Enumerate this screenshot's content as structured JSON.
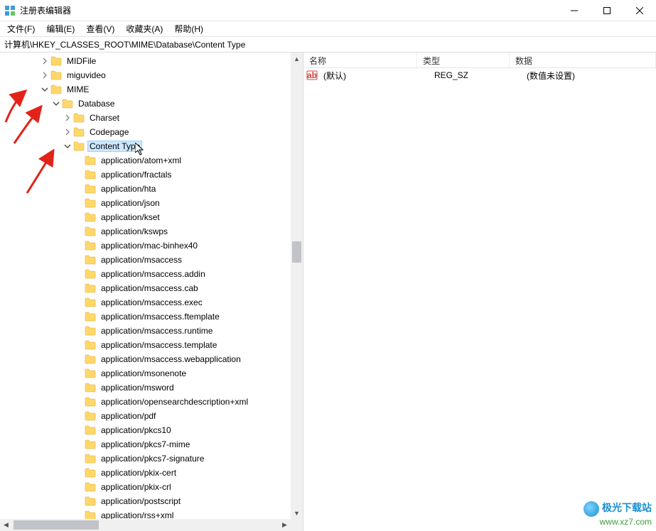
{
  "window": {
    "title": "注册表编辑器"
  },
  "menu": {
    "file": "文件(F)",
    "edit": "编辑(E)",
    "view": "查看(V)",
    "favorites": "收藏夹(A)",
    "help": "帮助(H)"
  },
  "address": {
    "path": "计算机\\HKEY_CLASSES_ROOT\\MIME\\Database\\Content Type"
  },
  "tree": {
    "nodes": [
      {
        "label": "MIDFile",
        "indent": 2,
        "exp": "closed"
      },
      {
        "label": "miguvideo",
        "indent": 2,
        "exp": "closed"
      },
      {
        "label": "MIME",
        "indent": 2,
        "exp": "open"
      },
      {
        "label": "Database",
        "indent": 3,
        "exp": "open"
      },
      {
        "label": "Charset",
        "indent": 4,
        "exp": "closed"
      },
      {
        "label": "Codepage",
        "indent": 4,
        "exp": "closed"
      },
      {
        "label": "Content Type",
        "indent": 4,
        "exp": "open",
        "selected": true
      },
      {
        "label": "application/atom+xml",
        "indent": 5,
        "exp": "none"
      },
      {
        "label": "application/fractals",
        "indent": 5,
        "exp": "none"
      },
      {
        "label": "application/hta",
        "indent": 5,
        "exp": "none"
      },
      {
        "label": "application/json",
        "indent": 5,
        "exp": "none"
      },
      {
        "label": "application/kset",
        "indent": 5,
        "exp": "none"
      },
      {
        "label": "application/kswps",
        "indent": 5,
        "exp": "none"
      },
      {
        "label": "application/mac-binhex40",
        "indent": 5,
        "exp": "none"
      },
      {
        "label": "application/msaccess",
        "indent": 5,
        "exp": "none"
      },
      {
        "label": "application/msaccess.addin",
        "indent": 5,
        "exp": "none"
      },
      {
        "label": "application/msaccess.cab",
        "indent": 5,
        "exp": "none"
      },
      {
        "label": "application/msaccess.exec",
        "indent": 5,
        "exp": "none"
      },
      {
        "label": "application/msaccess.ftemplate",
        "indent": 5,
        "exp": "none"
      },
      {
        "label": "application/msaccess.runtime",
        "indent": 5,
        "exp": "none"
      },
      {
        "label": "application/msaccess.template",
        "indent": 5,
        "exp": "none"
      },
      {
        "label": "application/msaccess.webapplication",
        "indent": 5,
        "exp": "none"
      },
      {
        "label": "application/msonenote",
        "indent": 5,
        "exp": "none"
      },
      {
        "label": "application/msword",
        "indent": 5,
        "exp": "none"
      },
      {
        "label": "application/opensearchdescription+xml",
        "indent": 5,
        "exp": "none"
      },
      {
        "label": "application/pdf",
        "indent": 5,
        "exp": "none"
      },
      {
        "label": "application/pkcs10",
        "indent": 5,
        "exp": "none"
      },
      {
        "label": "application/pkcs7-mime",
        "indent": 5,
        "exp": "none"
      },
      {
        "label": "application/pkcs7-signature",
        "indent": 5,
        "exp": "none"
      },
      {
        "label": "application/pkix-cert",
        "indent": 5,
        "exp": "none"
      },
      {
        "label": "application/pkix-crl",
        "indent": 5,
        "exp": "none"
      },
      {
        "label": "application/postscript",
        "indent": 5,
        "exp": "none"
      },
      {
        "label": "application/rss+xml",
        "indent": 5,
        "exp": "none"
      }
    ]
  },
  "list": {
    "headers": {
      "name": "名称",
      "type": "类型",
      "data": "数据"
    },
    "rows": [
      {
        "name": "(默认)",
        "type": "REG_SZ",
        "data": "(数值未设置)"
      }
    ]
  },
  "watermark": {
    "line1": "极光下载站",
    "line2": "www.xz7.com"
  }
}
